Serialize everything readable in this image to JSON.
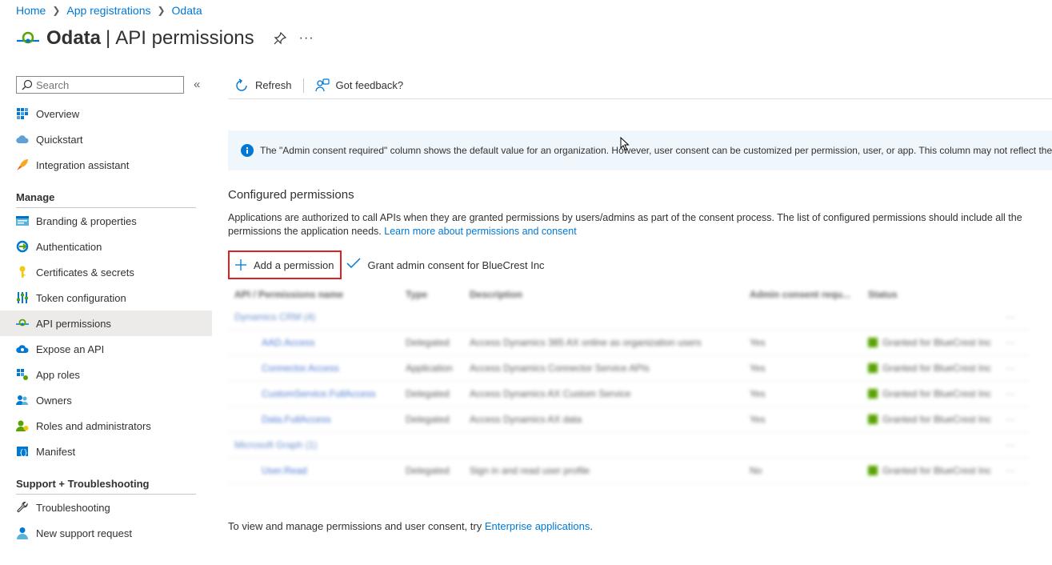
{
  "breadcrumb": [
    {
      "label": "Home"
    },
    {
      "label": "App registrations"
    },
    {
      "label": "Odata"
    }
  ],
  "title": {
    "app_name": "Odata",
    "divider": "|",
    "page": "API permissions",
    "more": "···"
  },
  "search": {
    "placeholder": "Search",
    "collapse": "«"
  },
  "nav": {
    "top_items": [
      {
        "label": "Overview",
        "icon": "overview-icon"
      },
      {
        "label": "Quickstart",
        "icon": "cloud-icon"
      },
      {
        "label": "Integration assistant",
        "icon": "rocket-icon"
      }
    ],
    "manage_heading": "Manage",
    "manage_items": [
      {
        "label": "Branding & properties",
        "icon": "branding-icon"
      },
      {
        "label": "Authentication",
        "icon": "authentication-icon"
      },
      {
        "label": "Certificates & secrets",
        "icon": "key-icon"
      },
      {
        "label": "Token configuration",
        "icon": "token-icon"
      },
      {
        "label": "API permissions",
        "icon": "api-permissions-icon",
        "active": true
      },
      {
        "label": "Expose an API",
        "icon": "cloud-expose-icon"
      },
      {
        "label": "App roles",
        "icon": "app-roles-icon"
      },
      {
        "label": "Owners",
        "icon": "owners-icon"
      },
      {
        "label": "Roles and administrators",
        "icon": "roles-icon"
      },
      {
        "label": "Manifest",
        "icon": "manifest-icon"
      }
    ],
    "support_heading": "Support + Troubleshooting",
    "support_items": [
      {
        "label": "Troubleshooting",
        "icon": "wrench-icon"
      },
      {
        "label": "New support request",
        "icon": "support-person-icon"
      }
    ]
  },
  "toolbar": {
    "refresh_label": "Refresh",
    "feedback_label": "Got feedback?"
  },
  "info_banner": {
    "text": "The \"Admin consent required\" column shows the default value for an organization. However, user consent can be customized per permission, user, or app. This column may not reflect the"
  },
  "configured": {
    "title": "Configured permissions",
    "description": "Applications are authorized to call APIs when they are granted permissions by users/admins as part of the consent process. The list of configured permissions should include all the permissions the application needs.",
    "learn_more": "Learn more about permissions and consent",
    "add_permission": "Add a permission",
    "grant_consent": "Grant admin consent for BlueCrest Inc"
  },
  "table": {
    "headers": {
      "name": "API / Permissions name",
      "type": "Type",
      "desc": "Description",
      "admin": "Admin consent requ...",
      "status": "Status"
    },
    "rows": [
      {
        "kind": "group",
        "name": "Dynamics CRM (4)"
      },
      {
        "kind": "item",
        "name": "AAD.Access",
        "type": "Delegated",
        "desc": "Access Dynamics 365 AX online as organization users",
        "admin": "Yes",
        "status": "Granted for BlueCrest Inc"
      },
      {
        "kind": "item",
        "name": "Connector.Access",
        "type": "Application",
        "desc": "Access Dynamics Connector Service APIs",
        "admin": "Yes",
        "status": "Granted for BlueCrest Inc"
      },
      {
        "kind": "item",
        "name": "CustomService.FullAccess",
        "type": "Delegated",
        "desc": "Access Dynamics AX Custom Service",
        "admin": "Yes",
        "status": "Granted for BlueCrest Inc"
      },
      {
        "kind": "item",
        "name": "Data.FullAccess",
        "type": "Delegated",
        "desc": "Access Dynamics AX data",
        "admin": "Yes",
        "status": "Granted for BlueCrest Inc"
      },
      {
        "kind": "group",
        "name": "Microsoft Graph (1)"
      },
      {
        "kind": "item",
        "name": "User.Read",
        "type": "Delegated",
        "desc": "Sign in and read user profile",
        "admin": "No",
        "status": "Granted for BlueCrest Inc"
      }
    ],
    "more": "···"
  },
  "footer": {
    "text": "To view and manage permissions and user consent, try",
    "link": "Enterprise applications",
    "suffix": "."
  },
  "colors": {
    "accent": "#0078d4",
    "highlight_box": "#e02020",
    "banner_bg": "#eff6fc",
    "granted": "#57a300"
  }
}
